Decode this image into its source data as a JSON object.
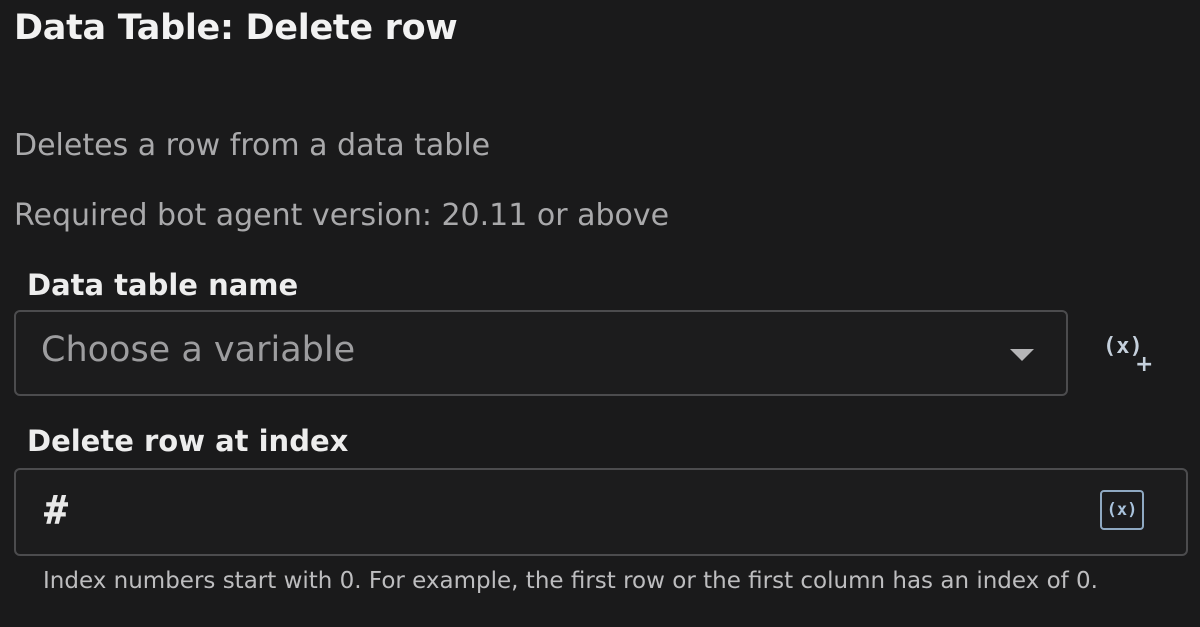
{
  "header": {
    "title": "Data Table: Delete row"
  },
  "info": {
    "description": "Deletes a row from a data table",
    "required_version": "Required bot agent version: 20.11 or above"
  },
  "fields": {
    "table_name": {
      "label": "Data table name",
      "placeholder": "Choose a variable",
      "selected_value": "",
      "caret_icon": "chevron-down-icon",
      "variable_button_icon": "insert-variable-icon"
    },
    "row_index": {
      "label": "Delete row at index",
      "value": "",
      "prefix_icon": "hash-icon",
      "variable_button_icon": "insert-variable-icon",
      "help_text": "Index numbers start with 0. For example, the first row or the first column has an index of 0."
    }
  },
  "icons": {
    "variable_symbol": "(x)",
    "plus_symbol": "+",
    "hash_symbol": "#"
  },
  "colors": {
    "background": "#1b1b1c",
    "field_border": "#4c4c4e",
    "accent_variable": "#8fa9c2"
  }
}
